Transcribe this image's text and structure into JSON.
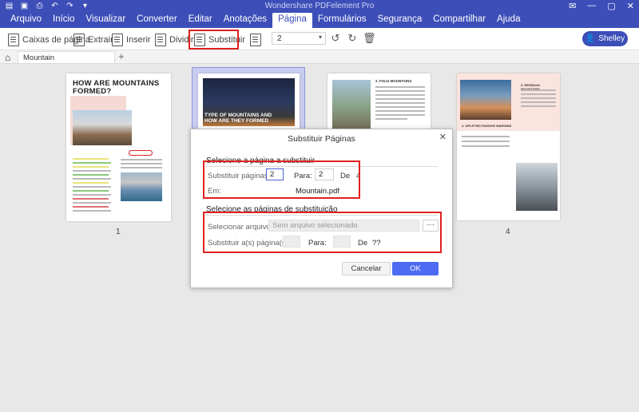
{
  "app": {
    "title": "Wondershare PDFelement Pro"
  },
  "menu": [
    "Arquivo",
    "Início",
    "Visualizar",
    "Converter",
    "Editar",
    "Anotações",
    "Página",
    "Formulários",
    "Segurança",
    "Compartilhar",
    "Ajuda"
  ],
  "menu_active": "Página",
  "toolbar": {
    "page_boxes": "Caixas de página",
    "extract": "Extrair",
    "insert": "Inserir",
    "split": "Dividir",
    "replace": "Substituir",
    "page_select_value": "2",
    "user": "Shelley"
  },
  "tabs": {
    "doc_name": "Mountain",
    "add": "+"
  },
  "pages": {
    "p1_title": "HOW ARE MOUNTAINS FORMED?",
    "p2_title": "TYPE OF MOUNTAINS AND HOW ARE THEY FORMED",
    "p3_heading": "2. FOLD MOUNTAINS",
    "p4_heading_a": "3. RESIDUAL MOUNTAINS",
    "p4_heading_b": "4. UPLIFTED PASSIVE MARGINS",
    "p1_number": "1",
    "p4_number": "4"
  },
  "dialog": {
    "title": "Substituir Páginas",
    "section1": "Selecione a página a substituir",
    "replace_pages_label": "Substituir páginas",
    "from_value": "2",
    "to_label": "Para:",
    "to_value": "2",
    "of_label": "De",
    "total_pages": "4",
    "in_label": "Em:",
    "in_value": "Mountain.pdf",
    "section2": "Selecione as páginas de substituição",
    "select_file_label": "Selecionar arquivo:",
    "select_file_placeholder": "Sem arquivo selecionado",
    "browse": "···",
    "replace_with_label": "Substituir a(s) página(s):",
    "to2_label": "Para:",
    "of2_label": "De",
    "of2_value": "??",
    "cancel": "Cancelar",
    "ok": "OK",
    "close": "✕"
  },
  "colors": {
    "brand": "#3d4eb8",
    "ok_button": "#4d6cf3",
    "highlight_red": "#e02020"
  }
}
